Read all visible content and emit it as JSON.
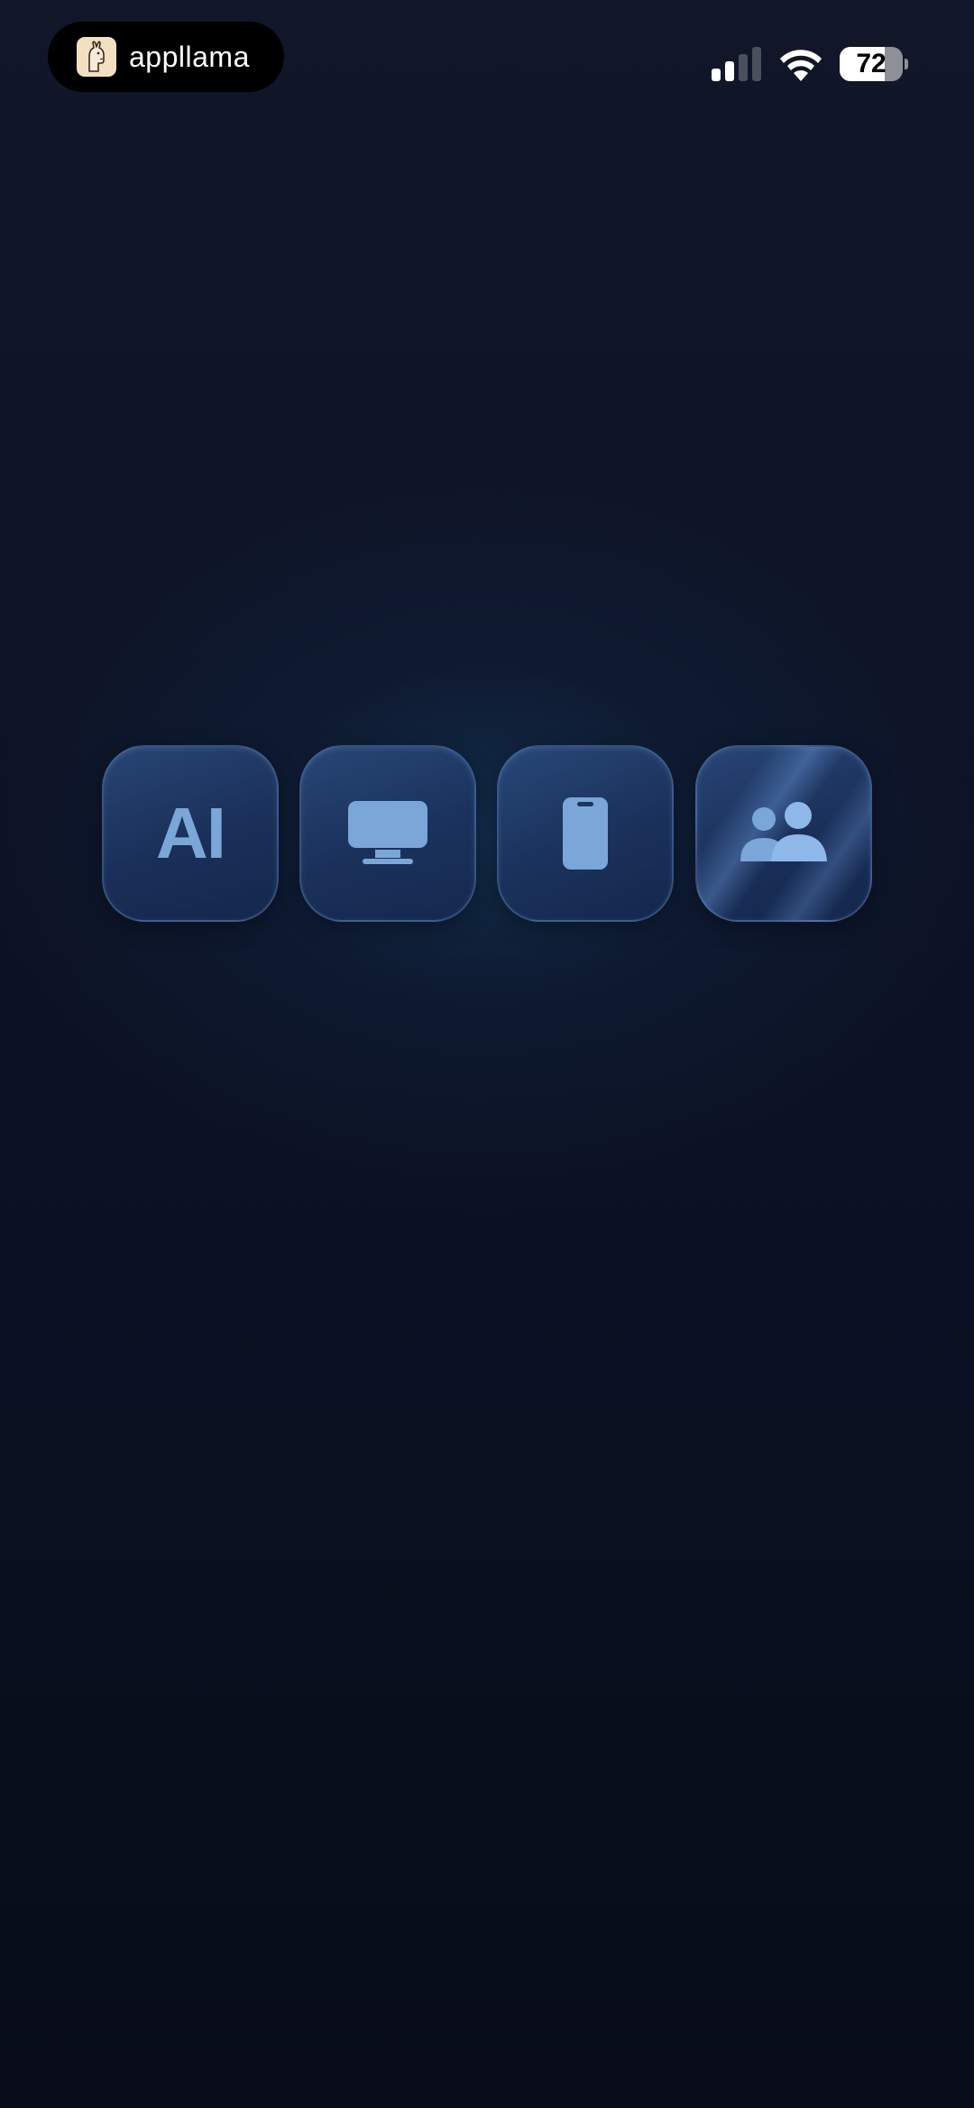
{
  "status_bar": {
    "app_name": "appllama",
    "battery_level": "72",
    "battery_fraction": 0.72,
    "signal_bars_active": 2,
    "signal_bars_total": 4,
    "icons": [
      "app-logo-icon",
      "cellular-signal-icon",
      "wifi-icon",
      "battery-icon"
    ]
  },
  "tiles": [
    {
      "label": "AI",
      "icon": "ai-text-icon"
    },
    {
      "icon": "desktop-monitor-icon"
    },
    {
      "icon": "smartphone-icon"
    },
    {
      "icon": "people-group-icon"
    }
  ],
  "colors": {
    "background_top": "#111628",
    "background_bottom": "#070c18",
    "tile_fill": "#1f3a66",
    "icon_blue": "#7aa6d8",
    "status_white": "#ffffff"
  }
}
